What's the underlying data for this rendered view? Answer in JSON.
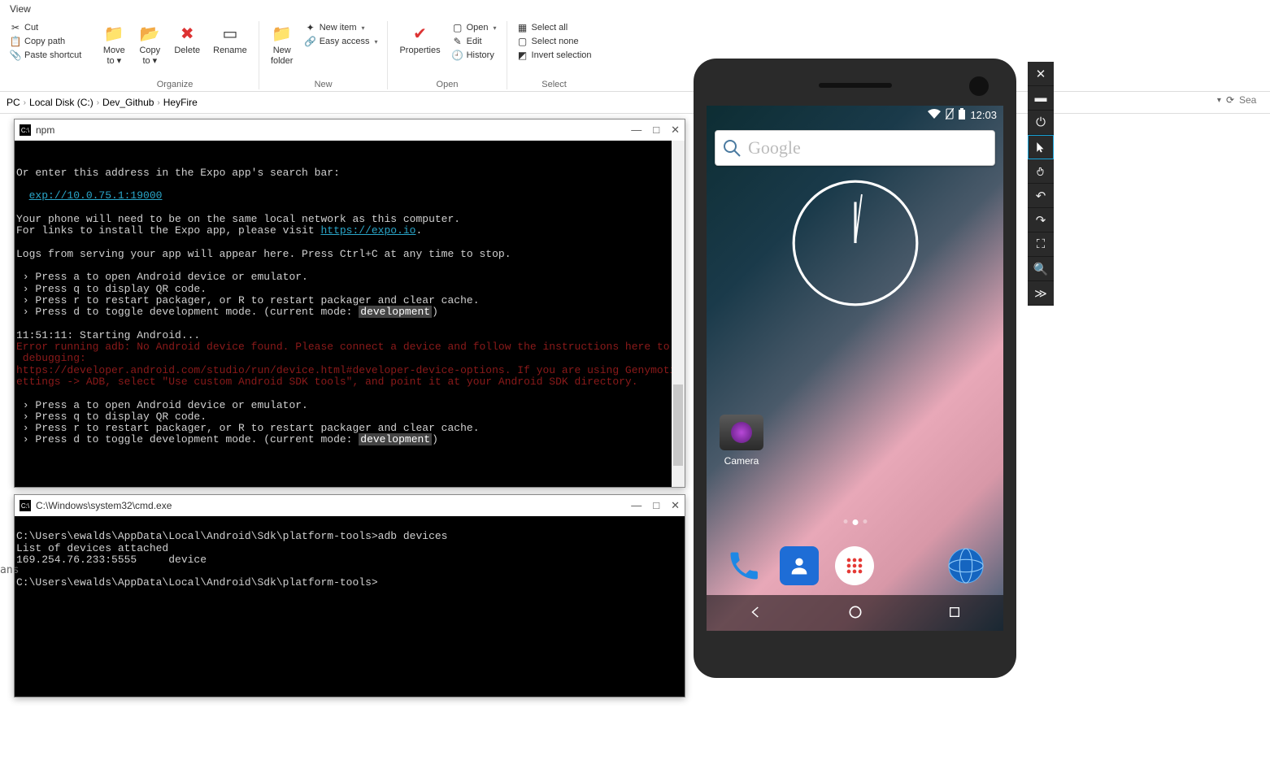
{
  "ribbon": {
    "tab": "View",
    "clipboard": {
      "cut": "Cut",
      "copypath": "Copy path",
      "pasteshortcut": "Paste shortcut"
    },
    "organize": {
      "label": "Organize",
      "moveto": "Move\nto ▾",
      "copyto": "Copy\nto ▾",
      "delete": "Delete",
      "rename": "Rename"
    },
    "new": {
      "label": "New",
      "newfolder": "New\nfolder",
      "newitem": "New item",
      "easyaccess": "Easy access"
    },
    "open": {
      "label": "Open",
      "properties": "Properties",
      "open": "Open",
      "edit": "Edit",
      "history": "History"
    },
    "select": {
      "label": "Select",
      "selectall": "Select all",
      "selectnone": "Select none",
      "invert": "Invert selection"
    }
  },
  "breadcrumb": [
    "PC",
    "Local Disk (C:)",
    "Dev_Github",
    "HeyFire"
  ],
  "search_placeholder": "Sea",
  "terminals": {
    "npm": {
      "title": "npm",
      "lines": {
        "l1": "Or enter this address in the Expo app's search bar:",
        "link1": "exp://10.0.75.1:19000",
        "l2": "Your phone will need to be on the same local network as this computer.",
        "l3a": "For links to install the Expo app, please visit ",
        "link2": "https://expo.io",
        "l3b": ".",
        "l4": "Logs from serving your app will appear here. Press Ctrl+C at any time to stop.",
        "p1": " › Press a to open Android device or emulator.",
        "p2": " › Press q to display QR code.",
        "p3": " › Press r to restart packager, or R to restart packager and clear cache.",
        "p4a": " › Press d to toggle development mode. (current mode: ",
        "p4b": "development",
        "p4c": ")",
        "s1": "11:51:11: Starting Android...",
        "e1": "Error running adb: No Android device found. Please connect a device and follow the instructions here to enable USB",
        "e2": " debugging:",
        "e3": "https://developer.android.com/studio/run/device.html#developer-device-options. If you are using Genymotion go to S",
        "e4": "ettings -> ADB, select \"Use custom Android SDK tools\", and point it at your Android SDK directory."
      }
    },
    "cmd": {
      "title": "C:\\Windows\\system32\\cmd.exe",
      "lines": {
        "c1": "C:\\Users\\ewalds\\AppData\\Local\\Android\\Sdk\\platform-tools>adb devices",
        "c2": "List of devices attached",
        "c3": "169.254.76.233:5555     device",
        "c4": "C:\\Users\\ewalds\\AppData\\Local\\Android\\Sdk\\platform-tools>"
      }
    }
  },
  "truncated": "ans",
  "phone": {
    "time": "12:03",
    "search_label": "Google",
    "camera_label": "Camera"
  }
}
